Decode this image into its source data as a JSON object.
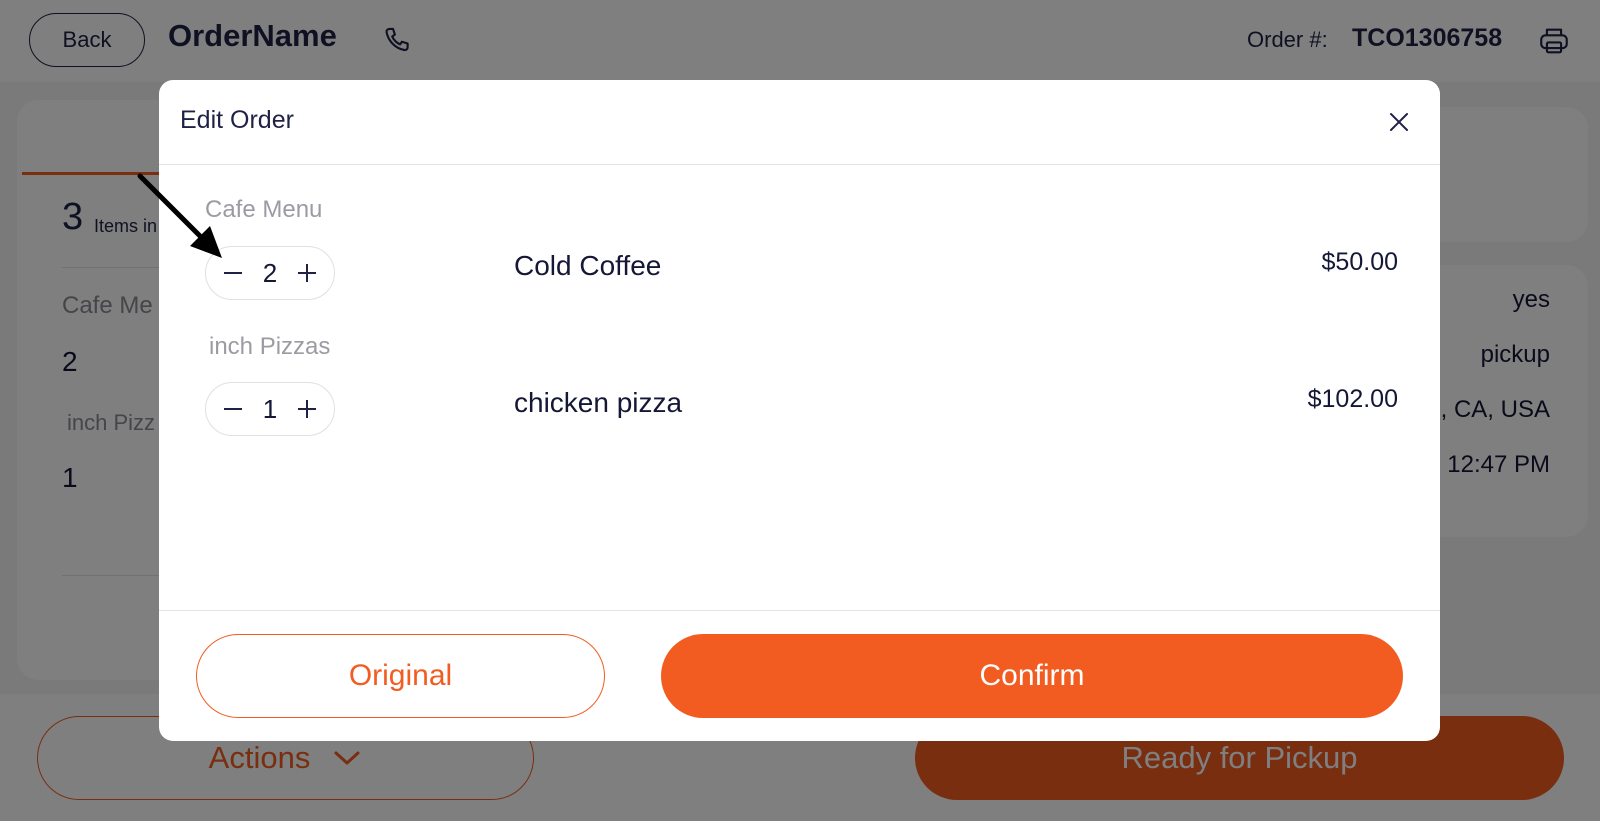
{
  "header": {
    "back_label": "Back",
    "order_name": "OrderName",
    "order_label": "Order #:",
    "order_number": "TCO1306758"
  },
  "background": {
    "items_count": "3",
    "items_label": "Items in",
    "category_1": "Cafe Me",
    "qty_1": "2",
    "category_2": "inch Pizz",
    "qty_2": "1",
    "info": [
      "yes",
      "pickup",
      "n, CA, USA",
      "@ 12:47 PM"
    ],
    "actions_label": "Actions",
    "ready_label": "Ready for Pickup"
  },
  "modal": {
    "title": "Edit Order",
    "items": [
      {
        "category": "Cafe Menu",
        "quantity": "2",
        "name": "Cold Coffee",
        "price": "$50.00"
      },
      {
        "category": "inch Pizzas",
        "quantity": "1",
        "name": "chicken pizza",
        "price": "$102.00"
      }
    ],
    "original_label": "Original",
    "confirm_label": "Confirm"
  },
  "colors": {
    "accent": "#f25c21",
    "text_dark": "#1f2245",
    "overlay": "rgba(0,0,0,0.5)"
  },
  "icons": [
    "phone-icon",
    "printer-icon",
    "close-icon",
    "chevron-down-icon",
    "minus-icon",
    "plus-icon",
    "annotation-arrow"
  ]
}
